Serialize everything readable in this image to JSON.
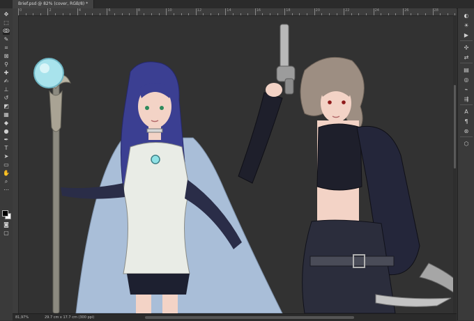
{
  "document": {
    "tab_title": "Brief.psd @ 82% (cover, RGB/8) *"
  },
  "ruler": {
    "top_labels": [
      "0",
      "2",
      "4",
      "6",
      "8",
      "10",
      "12",
      "14",
      "16",
      "18",
      "20",
      "22",
      "24",
      "26",
      "28"
    ]
  },
  "status": {
    "zoom": "81,97%",
    "doc_info": "29.7 cm x 17.7 cm (300 ppi)"
  },
  "toolbar": {
    "tools": [
      {
        "name": "move-tool-icon",
        "glyph": "✥"
      },
      {
        "name": "marquee-tool-icon",
        "glyph": "⬚"
      },
      {
        "name": "lasso-tool-icon",
        "glyph": "ↂ"
      },
      {
        "name": "quick-select-tool-icon",
        "glyph": "✎"
      },
      {
        "name": "crop-tool-icon",
        "glyph": "⌗"
      },
      {
        "name": "frame-tool-icon",
        "glyph": "⊠"
      },
      {
        "name": "eyedropper-tool-icon",
        "glyph": "⚲"
      },
      {
        "name": "healing-brush-tool-icon",
        "glyph": "✚"
      },
      {
        "name": "brush-tool-icon",
        "glyph": "✍"
      },
      {
        "name": "clone-stamp-tool-icon",
        "glyph": "⊥"
      },
      {
        "name": "history-brush-tool-icon",
        "glyph": "↺"
      },
      {
        "name": "eraser-tool-icon",
        "glyph": "◩"
      },
      {
        "name": "gradient-tool-icon",
        "glyph": "▦"
      },
      {
        "name": "blur-tool-icon",
        "glyph": "◆"
      },
      {
        "name": "dodge-tool-icon",
        "glyph": "●"
      },
      {
        "name": "pen-tool-icon",
        "glyph": "✒"
      },
      {
        "name": "type-tool-icon",
        "glyph": "T"
      },
      {
        "name": "path-select-tool-icon",
        "glyph": "➤"
      },
      {
        "name": "rectangle-tool-icon",
        "glyph": "▭"
      },
      {
        "name": "hand-tool-icon",
        "glyph": "✋"
      },
      {
        "name": "zoom-tool-icon",
        "glyph": "⌕"
      },
      {
        "name": "more-tools-icon",
        "glyph": "⋯"
      }
    ],
    "selected_index": 2
  },
  "right_panel": {
    "icons": [
      {
        "name": "color-panel-icon",
        "glyph": "◐"
      },
      {
        "name": "adjustments-panel-icon",
        "glyph": "☀"
      },
      {
        "name": "play-panel-icon",
        "glyph": "▶"
      },
      {
        "name": "brush-settings-panel-icon",
        "glyph": "✣"
      },
      {
        "name": "clone-source-panel-icon",
        "glyph": "⇄"
      },
      {
        "name": "layers-panel-icon",
        "glyph": "▤"
      },
      {
        "name": "channels-panel-icon",
        "glyph": "◎"
      },
      {
        "name": "paths-panel-icon",
        "glyph": "⌁"
      },
      {
        "name": "properties-panel-icon",
        "glyph": "⇶"
      },
      {
        "name": "character-panel-icon",
        "glyph": "A"
      },
      {
        "name": "paragraph-panel-icon",
        "glyph": "¶"
      },
      {
        "name": "glyphs-panel-icon",
        "glyph": "⊛"
      },
      {
        "name": "3d-panel-icon",
        "glyph": "⬡"
      }
    ]
  },
  "colors": {
    "app_bg": "#323232",
    "panel_bg": "#3a3a3a",
    "mage_cape": "#a9bed8",
    "mage_hair": "#3b3f92",
    "mage_dress": "#e9ece6",
    "gunner_outfit": "#1e1f2b",
    "gunner_hair": "#9d8e82",
    "skin": "#f3d3c6",
    "staff_orb": "#a8e3ec"
  }
}
